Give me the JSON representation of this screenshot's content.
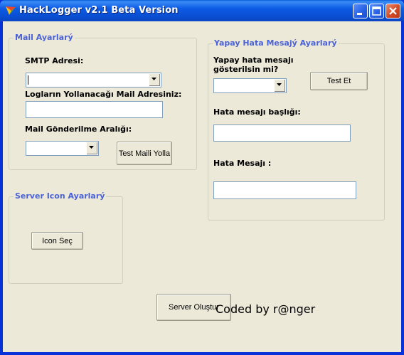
{
  "window": {
    "title": "HackLogger v2.1 Beta Version",
    "icon": "hacklogger-app-icon",
    "controls": [
      "minimize",
      "maximize",
      "close"
    ]
  },
  "mail_group": {
    "legend": "Mail Ayarlarý",
    "smtp_label": "SMTP Adresi:",
    "smtp_value": "",
    "recipient_label": "Logların Yollanacağı Mail Adresiniz:",
    "recipient_value": "",
    "interval_label": "Mail Gönderilme Aralığı:",
    "interval_value": "",
    "test_mail_button": "Test Maili Yolla"
  },
  "fake_error_group": {
    "legend": "Yapay Hata Mesajý Ayarlarý",
    "show_label_line1": "Yapay hata mesajı",
    "show_label_line2": "gösterilsin mi?",
    "show_value": "",
    "test_button": "Test Et",
    "error_title_label": "Hata mesajı başlığı:",
    "error_title_value": "",
    "error_message_label": "Hata Mesajı :",
    "error_message_value": ""
  },
  "icon_group": {
    "legend": "Server Icon Ayarlarý",
    "select_icon_button": "Icon Seç"
  },
  "create_server_button": "Server Oluştur",
  "credit": "Coded by r@nger",
  "colors": {
    "titlebar": "#0a4fd3",
    "face": "#ece9d8",
    "group_legend": "#4b62d6",
    "close_button": "#d44a24"
  }
}
